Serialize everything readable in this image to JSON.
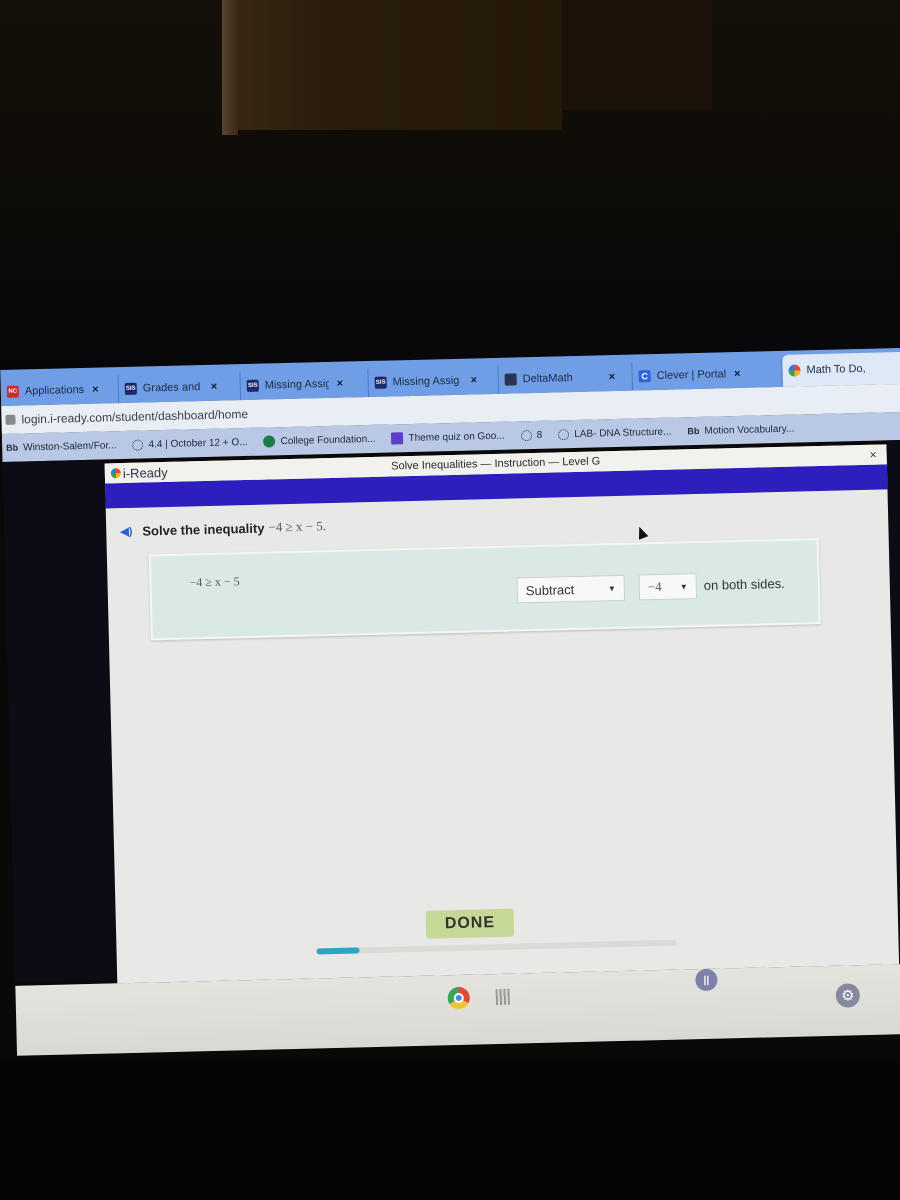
{
  "browser": {
    "tabs": [
      {
        "favicon": "nc-icon",
        "favicon_text": "NC",
        "favicon_color": "#c9302c",
        "label": "Applications",
        "closable": true
      },
      {
        "favicon": "sis-icon",
        "favicon_text": "SIS",
        "favicon_color": "#1c2a6b",
        "label": "Grades and At",
        "closable": true
      },
      {
        "favicon": "sis-icon",
        "favicon_text": "SIS",
        "favicon_color": "#1c2a6b",
        "label": "Missing Assig",
        "closable": true
      },
      {
        "favicon": "sis-icon",
        "favicon_text": "SIS",
        "favicon_color": "#1c2a6b",
        "label": "Missing Assig",
        "closable": true
      },
      {
        "favicon": "deltamath-icon",
        "favicon_text": "",
        "favicon_color": "#2a3350",
        "label": "DeltaMath",
        "closable": true
      },
      {
        "favicon": "clever-icon",
        "favicon_text": "C",
        "favicon_color": "#2f63e0",
        "label": "Clever | Portal",
        "closable": true
      },
      {
        "favicon": "iready-icon",
        "favicon_text": "",
        "favicon_color": "#3a9e53",
        "label": "Math To Do,",
        "closable": false,
        "active": true
      }
    ],
    "url": "login.i-ready.com/student/dashboard/home",
    "bookmarks": [
      {
        "icon": "blackboard-icon",
        "icon_text": "Bb",
        "label": "Winston-Salem/For..."
      },
      {
        "icon": "loading-icon",
        "icon_text": "",
        "label": "4.4 | October 12 + O..."
      },
      {
        "icon": "cfnc-icon",
        "icon_text": "",
        "label": "College Foundation..."
      },
      {
        "icon": "forms-icon",
        "icon_text": "",
        "label": "Theme quiz on Goo..."
      },
      {
        "icon": "loading-icon",
        "icon_text": "",
        "label": "8"
      },
      {
        "icon": "loading-icon",
        "icon_text": "",
        "label": "LAB- DNA Structure..."
      },
      {
        "icon": "blackboard-icon",
        "icon_text": "Bb",
        "label": "Motion Vocabulary..."
      }
    ]
  },
  "app": {
    "logo": "i-Ready",
    "lesson_title": "Solve Inequalities — Instruction — Level G",
    "close_label": "×",
    "accent_color": "#2c1fbe",
    "question_prefix": "Solve the inequality",
    "question_math": "−4 ≥ x − 5.",
    "work": {
      "equation": "−4 ≥ x − 5",
      "operation_dropdown": "Subtract",
      "value_dropdown": "−4",
      "suffix": "on both sides."
    },
    "done_label": "DONE",
    "progress": 0.12,
    "progress_color": "#2fa3c4"
  },
  "shelf": {
    "icons": [
      "chrome-icon",
      "qr-app-icon",
      "pause-icon",
      "settings-gear-icon"
    ],
    "pause_glyph": "||",
    "gear_glyph": "⚙"
  }
}
